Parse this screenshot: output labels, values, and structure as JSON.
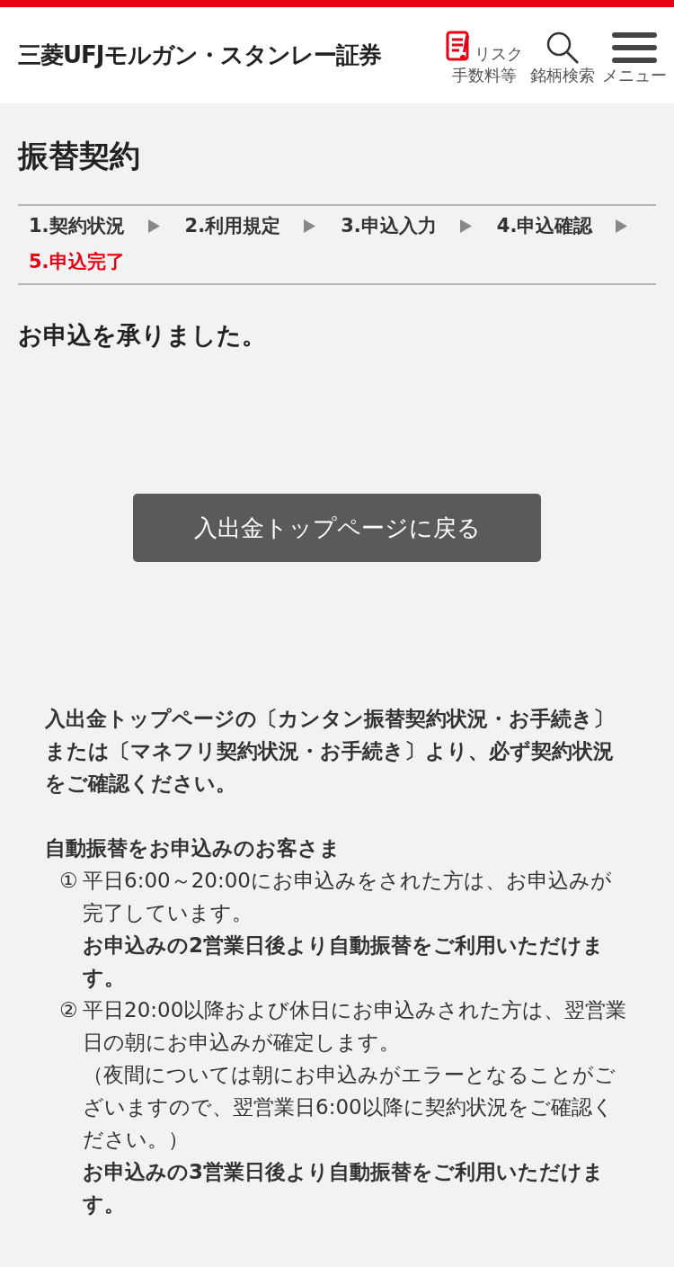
{
  "header": {
    "logo": "三菱UFJモルガン・スタンレー証券",
    "actions": [
      {
        "kind": "risk",
        "top": "リスク",
        "label": "手数料等"
      },
      {
        "kind": "search",
        "label": "銘柄検索"
      },
      {
        "kind": "menu",
        "label": "メニュー"
      }
    ]
  },
  "page_title": "振替契約",
  "steps": [
    {
      "label": "1.契約状況",
      "selected": false
    },
    {
      "label": "2.利用規定",
      "selected": false
    },
    {
      "label": "3.申込入力",
      "selected": false
    },
    {
      "label": "4.申込確認",
      "selected": false
    },
    {
      "label": "5.申込完了",
      "selected": true
    }
  ],
  "message": "お申込を承りました。",
  "back_button": "入出金トップページに戻る",
  "notes": {
    "intro": "入出金トップページの〔カンタン振替契約状況・お手続き〕または〔マネフリ契約状況・お手続き〕より、必ず契約状況をご確認ください。",
    "heading": "自動振替をお申込みのお客さま",
    "items": [
      {
        "marker": "①",
        "lines": [
          {
            "kind": "plain",
            "text": "平日6:00～20:00にお申込みをされた方は、お申込みが完了しています。"
          },
          {
            "kind": "emphasis",
            "text": "お申込みの2営業日後より自動振替をご利用いただけます。"
          }
        ]
      },
      {
        "marker": "②",
        "lines": [
          {
            "kind": "plain",
            "text": "平日20:00以降および休日にお申込みされた方は、翌営業日の朝にお申込みが確定します。"
          },
          {
            "kind": "plain",
            "text": "（夜間については朝にお申込みがエラーとなることがございますので、翌営業日6:00以降に契約状況をご確認ください。）"
          },
          {
            "kind": "emphasis",
            "text": "お申込みの3営業日後より自動振替をご利用いただけます。"
          }
        ]
      }
    ]
  }
}
